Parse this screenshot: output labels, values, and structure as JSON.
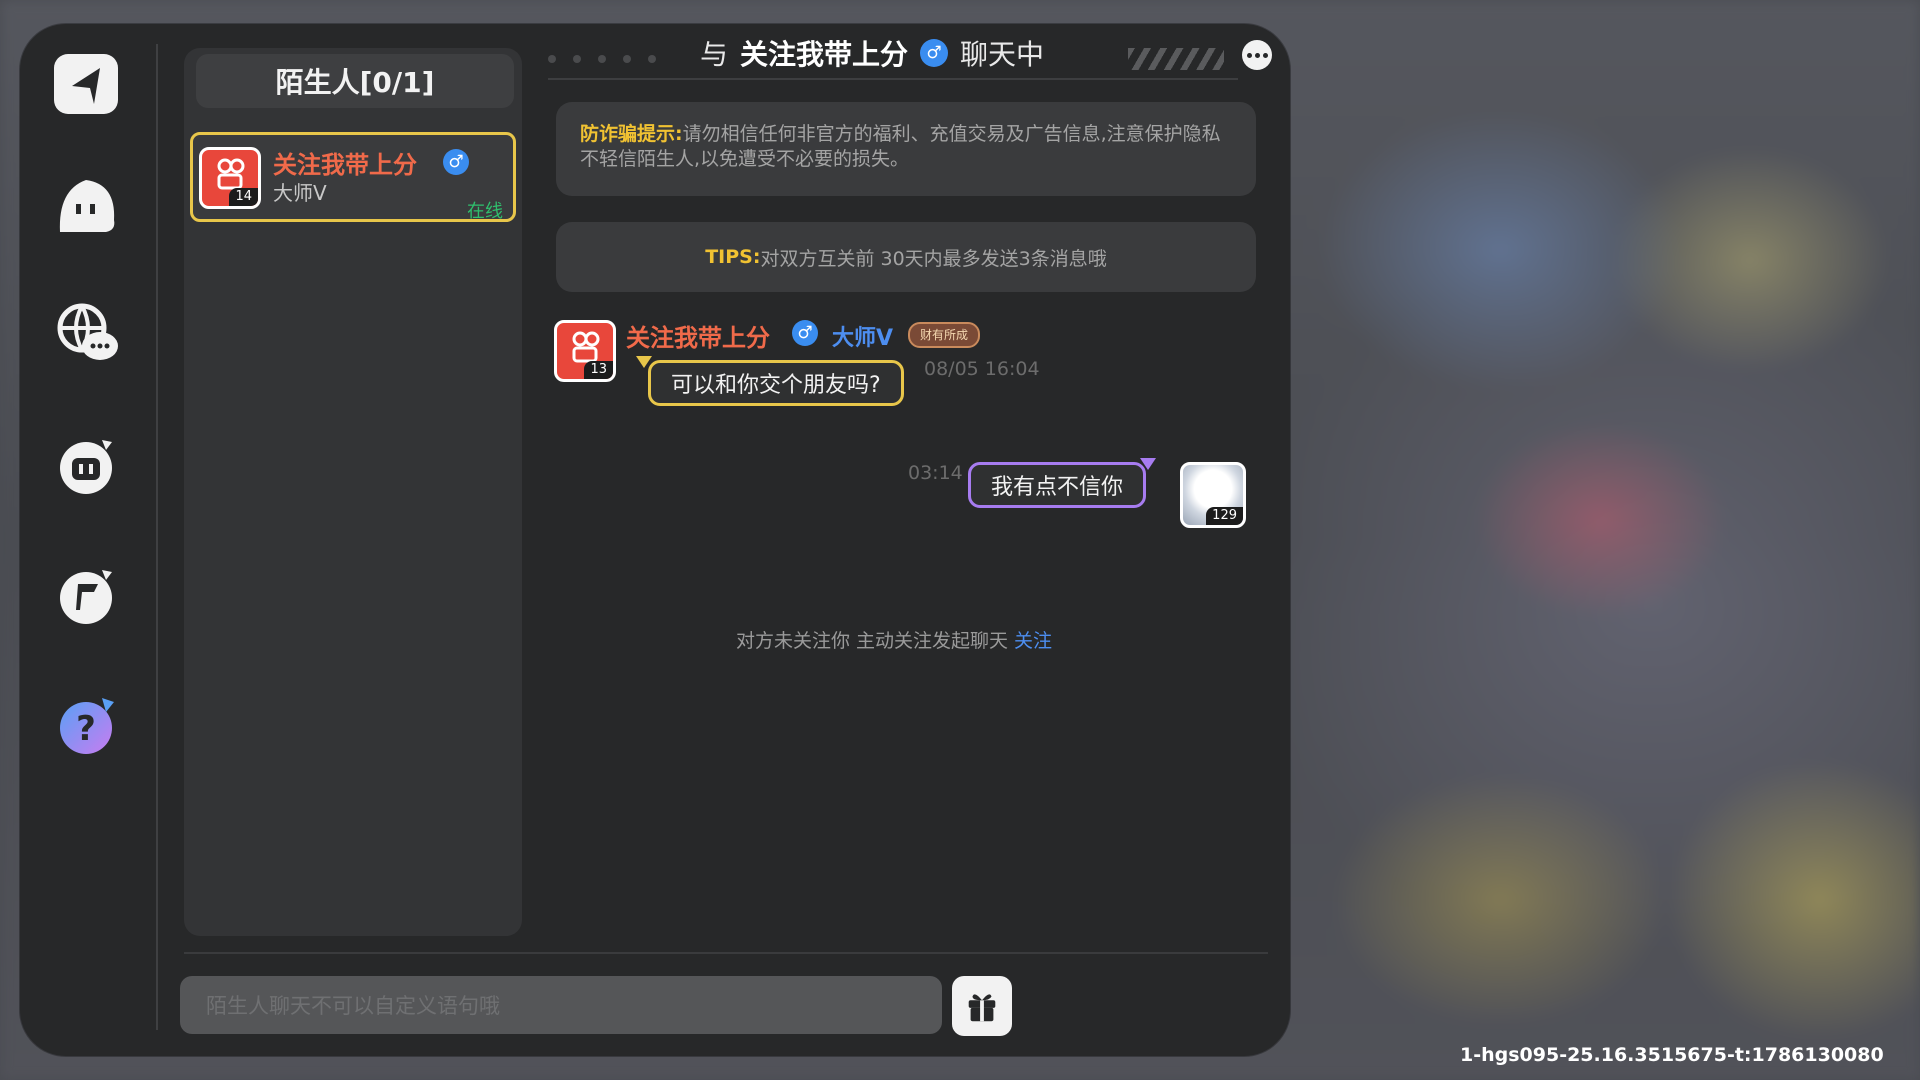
{
  "list": {
    "header": "陌生人[0/1]",
    "contacts": [
      {
        "name": "关注我带上分",
        "gender_icon": "♂",
        "title": "大师V",
        "status": "在线",
        "level": "14"
      }
    ]
  },
  "chat": {
    "title_prefix": "与",
    "title_name": "关注我带上分",
    "title_gender": "♂",
    "title_suffix": "聊天中",
    "notice_label": "防诈骗提示:",
    "notice_text": "请勿相信任何非官方的福利、充值交易及广告信息,注意保护隐私不轻信陌生人,以免遭受不必要的损失。",
    "tips_label": "TIPS:",
    "tips_text": "对双方互关前 30天内最多发送3条消息哦",
    "messages": [
      {
        "sender": "关注我带上分",
        "gender": "♂",
        "title": "大师V",
        "tag": "财有所成",
        "level": "13",
        "time": "08/05 16:04",
        "text": "可以和你交个朋友吗?"
      },
      {
        "sender": "self",
        "level": "129",
        "time": "03:14",
        "text": "我有点不信你"
      }
    ],
    "follow_hint": "对方未关注你 主动关注发起聊天",
    "follow_link": "关注"
  },
  "input": {
    "placeholder": "陌生人聊天不可以自定义语句哦"
  },
  "icons": {
    "rail": [
      "back-arrow-icon",
      "hooded-character-icon",
      "global-chat-icon",
      "robot-chat-icon",
      "flag-chat-icon",
      "help-question-icon"
    ],
    "gift": "gift-icon",
    "more": "more-options-icon"
  },
  "colors": {
    "accent_gold": "#e8c64a",
    "name_red": "#f06a4a",
    "link_blue": "#4d8ef0",
    "self_bubble": "#a77cf0",
    "online_green": "#2fbf6d"
  },
  "version": "1-hgs095-25.16.3515675-t:1786130080"
}
